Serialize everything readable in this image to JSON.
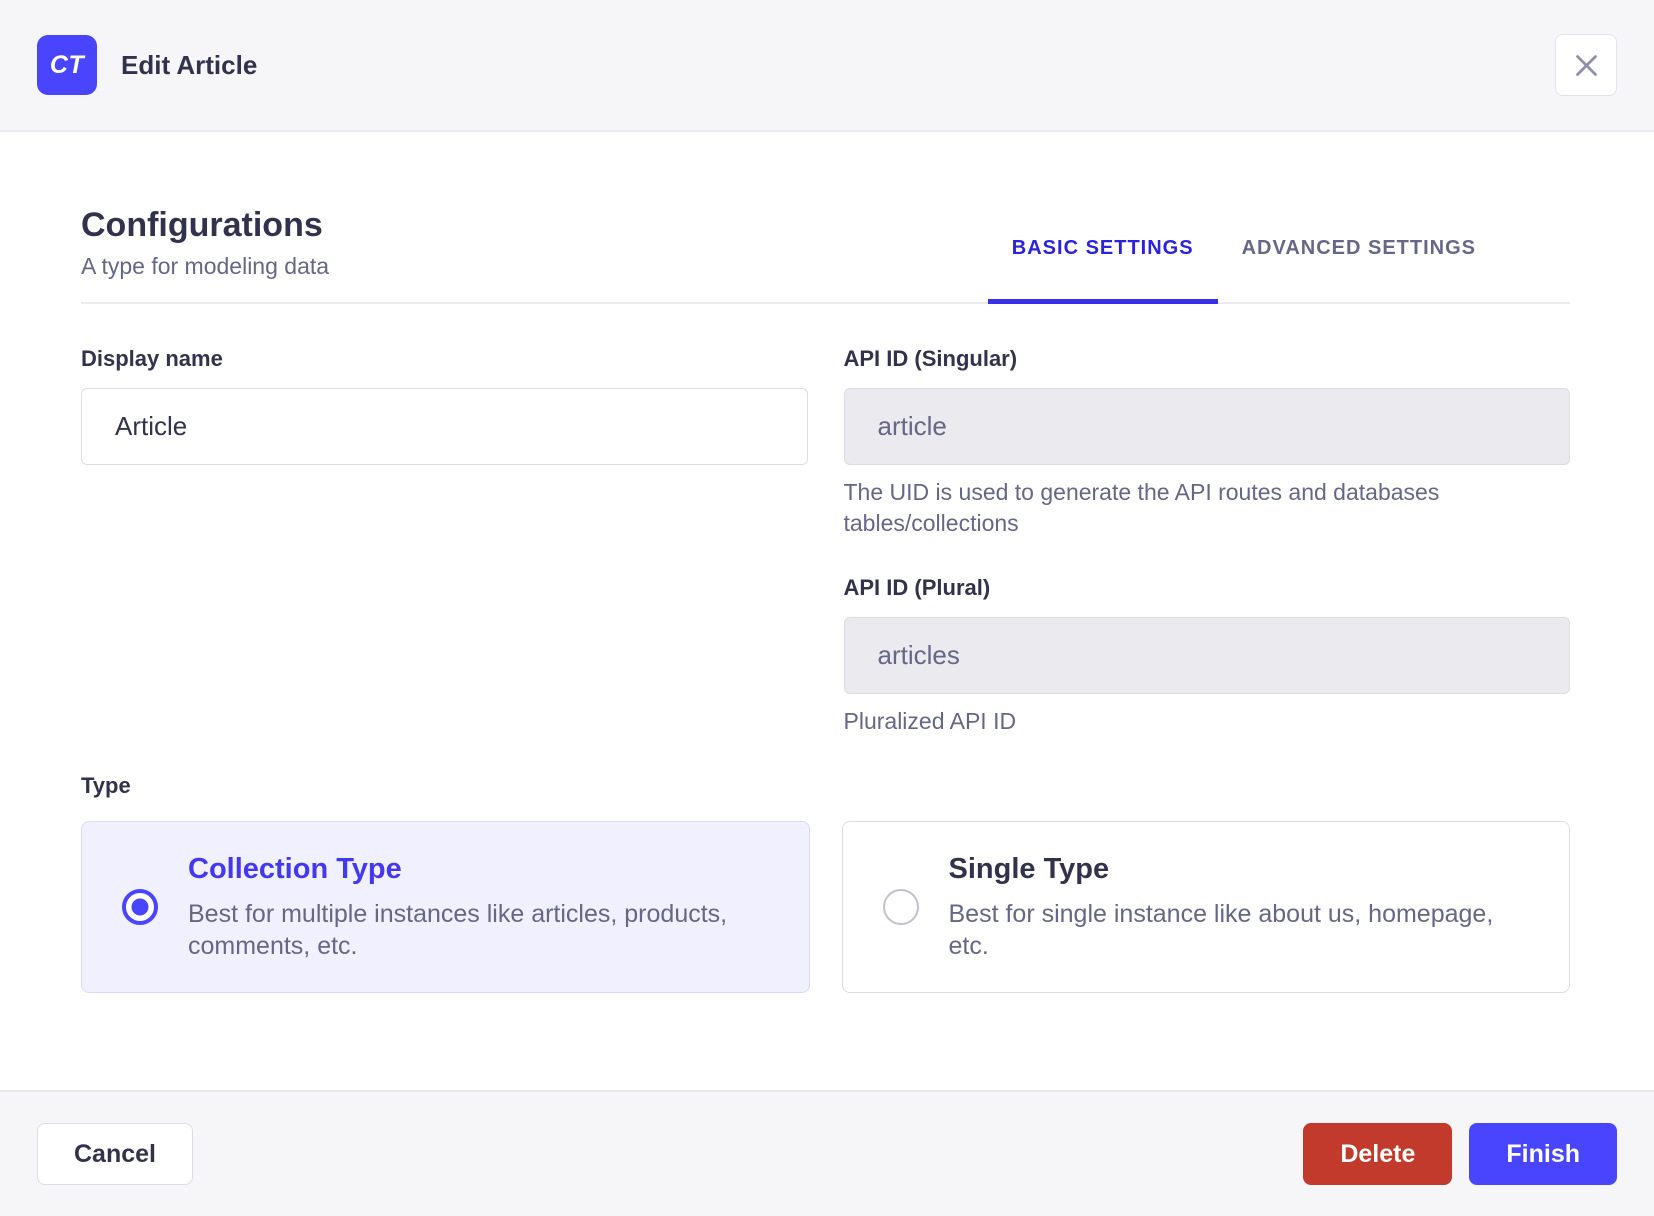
{
  "header": {
    "badge": "CT",
    "title": "Edit Article"
  },
  "section": {
    "title": "Configurations",
    "subtitle": "A type for modeling data",
    "tabs": [
      {
        "label": "BASIC SETTINGS",
        "active": true
      },
      {
        "label": "ADVANCED SETTINGS",
        "active": false
      }
    ]
  },
  "form": {
    "display_name": {
      "label": "Display name",
      "value": "Article"
    },
    "api_id_singular": {
      "label": "API ID (Singular)",
      "value": "article",
      "helper": "The UID is used to generate the API routes and databases tables/collections"
    },
    "api_id_plural": {
      "label": "API ID (Plural)",
      "value": "articles",
      "helper": "Pluralized API ID"
    },
    "type": {
      "label": "Type",
      "options": [
        {
          "title": "Collection Type",
          "description": "Best for multiple instances like articles, products, comments, etc.",
          "selected": true
        },
        {
          "title": "Single Type",
          "description": "Best for single instance like about us, homepage, etc.",
          "selected": false
        }
      ]
    }
  },
  "footer": {
    "cancel": "Cancel",
    "delete": "Delete",
    "finish": "Finish"
  },
  "colors": {
    "accent": "#4945ff",
    "accent_deep": "#2b22e0",
    "danger": "#c23a2b",
    "surface": "#f6f6f9",
    "border": "#dcdce4",
    "text_primary": "#32324d",
    "text_secondary": "#666687",
    "selected_card_bg": "#f0f0ff"
  }
}
